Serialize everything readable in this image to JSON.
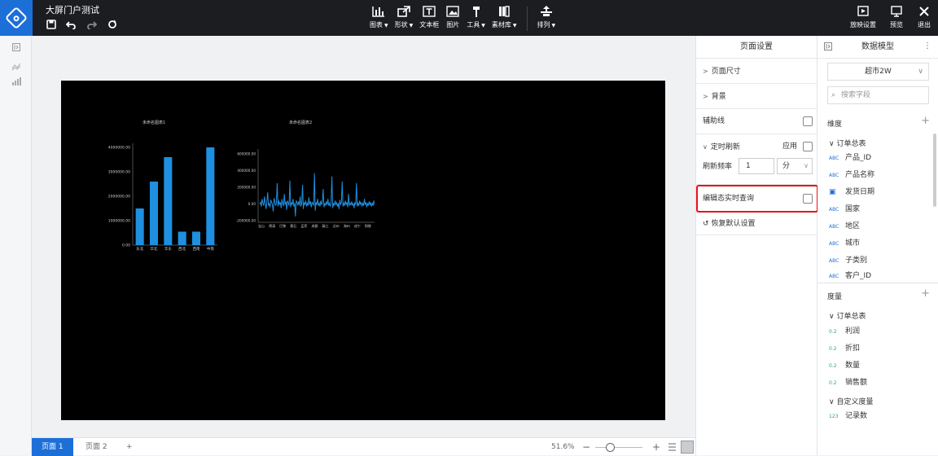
{
  "app": {
    "title": "大屏门户测试"
  },
  "toolbar": {
    "items": [
      {
        "label": "图表",
        "icon": "bar-chart-icon",
        "dropdown": true
      },
      {
        "label": "形状",
        "icon": "shape-icon",
        "dropdown": true
      },
      {
        "label": "文本框",
        "icon": "text-box-icon",
        "dropdown": false
      },
      {
        "label": "图片",
        "icon": "image-icon",
        "dropdown": false
      },
      {
        "label": "工具",
        "icon": "tools-icon",
        "dropdown": true
      },
      {
        "label": "素材库",
        "icon": "library-icon",
        "dropdown": true
      }
    ],
    "arrange": {
      "label": "排列",
      "icon": "arrange-icon"
    }
  },
  "right_tools": {
    "play_settings": "放映设置",
    "preview": "预览",
    "exit": "退出"
  },
  "bottom": {
    "pages": [
      "页面 1",
      "页面 2"
    ],
    "add": "+",
    "zoom": "51.6%"
  },
  "page_settings": {
    "title": "页面设置",
    "page_size": "页面尺寸",
    "background": "背景",
    "guides": "辅助线",
    "timed_refresh": "定时刷新",
    "apply": "应用",
    "refresh_rate_label": "刷新频率",
    "refresh_rate_value": "1",
    "refresh_unit": "分",
    "edit_realtime": "编辑态实时查询",
    "restore": "恢复默认设置"
  },
  "data_model": {
    "title": "数据模型",
    "selected_model": "超市2W",
    "search_placeholder": "搜索字段",
    "dimensions_label": "维度",
    "dim_group": "订单总表",
    "dimensions": [
      {
        "tag": "ABC",
        "name": "产品_ID"
      },
      {
        "tag": "ABC",
        "name": "产品名称"
      },
      {
        "tag": "DATE",
        "name": "发货日期"
      },
      {
        "tag": "ABC",
        "name": "国家"
      },
      {
        "tag": "ABC",
        "name": "地区"
      },
      {
        "tag": "ABC",
        "name": "城市"
      },
      {
        "tag": "ABC",
        "name": "子类别"
      },
      {
        "tag": "ABC",
        "name": "客户_ID"
      }
    ],
    "measures_label": "度量",
    "measure_group": "订单总表",
    "measures": [
      {
        "tag": "0.2",
        "name": "利润"
      },
      {
        "tag": "0.2",
        "name": "折扣"
      },
      {
        "tag": "0.2",
        "name": "数量"
      },
      {
        "tag": "0.2",
        "name": "销售额"
      }
    ],
    "custom_group": "自定义度量",
    "custom_measures": [
      {
        "tag": "123",
        "name": "记录数"
      }
    ]
  },
  "chart_data": [
    {
      "type": "bar",
      "title": "未命名图表1",
      "categories": [
        "东北",
        "华北",
        "华东",
        "西北",
        "西南",
        "中南"
      ],
      "values": [
        1500000,
        2600000,
        3600000,
        550000,
        550000,
        4000000
      ],
      "ylim": [
        0,
        4000000
      ],
      "yticks": [
        "0.00",
        "1000000.00",
        "2000000.00",
        "3000000.00",
        "4000000.00"
      ],
      "color": "#1f8fe0"
    },
    {
      "type": "line",
      "title": "未命名图表2",
      "ylim": [
        -200000,
        600000
      ],
      "yticks": [
        "-200000.00",
        "0.00",
        "200000.00",
        "400000.00",
        "600000.00"
      ],
      "xticks": [
        "宝山",
        "德清",
        "巴黎",
        "黄石",
        "孟菲",
        "成都",
        "赣江",
        "达州",
        "海州",
        "成宁",
        "铜陵",
        "韩城"
      ],
      "color": "#1f8fe0",
      "values": [
        0,
        20000,
        -30000,
        60000,
        10000,
        -20000,
        90000,
        5000,
        -60000,
        30000,
        140000,
        -20000,
        10000,
        -40000,
        50000,
        20000,
        -10000,
        -90000,
        70000,
        30000,
        -20000,
        10000,
        250000,
        -30000,
        40000,
        -10000,
        20000,
        -50000,
        60000,
        0,
        -20000,
        120000,
        -10000,
        30000,
        -70000,
        40000,
        10000,
        -20000,
        280000,
        -40000,
        20000,
        -10000,
        60000,
        -30000,
        10000,
        -150000,
        40000,
        20000,
        -10000,
        30000,
        -20000,
        90000,
        -30000,
        10000,
        230000,
        -60000,
        20000,
        -10000,
        40000,
        -30000,
        10000,
        -20000,
        80000,
        -10000,
        30000,
        -40000,
        20000,
        10000,
        -20000,
        370000,
        -80000,
        20000,
        -10000,
        60000,
        -20000,
        10000,
        -30000,
        40000,
        -10000,
        20000,
        180000,
        -40000,
        10000,
        -20000,
        30000,
        -10000,
        60000,
        -20000,
        10000,
        -30000,
        20000,
        330000,
        -50000,
        10000,
        -20000,
        40000,
        -10000,
        20000,
        -30000,
        10000,
        -60000,
        50000,
        -10000,
        20000,
        270000,
        -30000,
        10000,
        -20000,
        40000,
        -10000,
        20000,
        -40000,
        120000,
        -20000,
        10000,
        -10000,
        30000,
        -20000,
        10000,
        -50000,
        20000,
        -10000,
        250000,
        -30000,
        10000,
        -20000,
        40000,
        -10000,
        20000,
        -30000,
        10000,
        -20000,
        60000,
        -10000,
        20000,
        -40000,
        10000,
        -20000,
        30000,
        -10000,
        20000,
        -30000,
        10000,
        -20000,
        40000,
        -10000,
        20000,
        -10000,
        30000,
        -20000,
        10000,
        -10000,
        20000
      ]
    }
  ]
}
